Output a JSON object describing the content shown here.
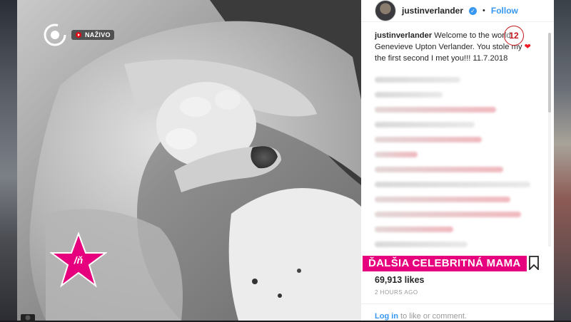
{
  "tv_overlay": {
    "live_label": "NAŽIVO",
    "show_tag": "ĎALŠIA CELEBRITNÁ MAMA"
  },
  "post": {
    "username": "justinverlander",
    "follow_label": "Follow",
    "caption_username": "justinverlander",
    "caption_part1": " Welcome to the world Genevieve Upton Verlander. You stole my ",
    "caption_part2": " the first second I met you!!! 11.7.2018",
    "annotation_number": "12",
    "likes": "69,913 likes",
    "time_ago": "2 HOURS AGO",
    "login_link": "Log in",
    "login_suffix": " to like or comment."
  },
  "colors": {
    "follow_blue": "#3897f0",
    "banner_pink": "#e6007e",
    "heart_red": "#ed1c24"
  },
  "icons": [
    "channel-logo-icon",
    "live-dot-icon",
    "verified-badge-icon",
    "heart-icon",
    "bookmark-icon",
    "camera-icon",
    "star-logo-icon"
  ]
}
